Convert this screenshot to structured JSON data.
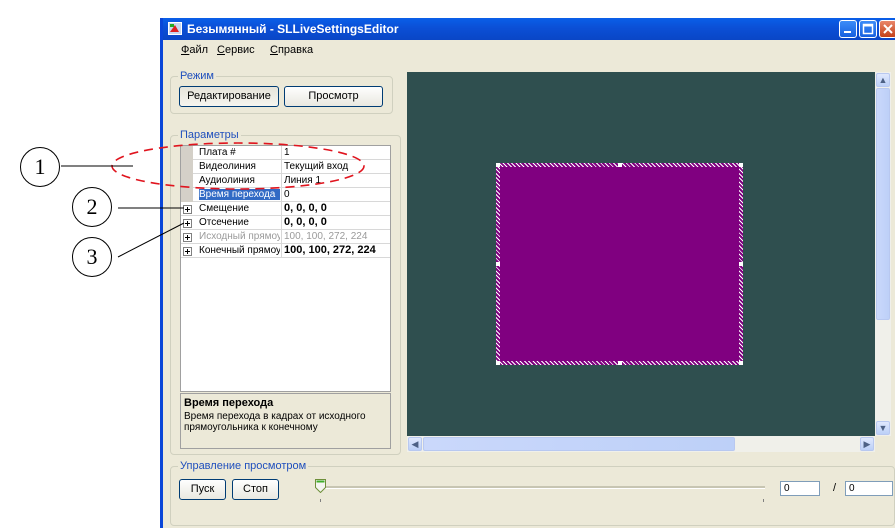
{
  "window": {
    "title": "Безымянный - SLLiveSettingsEditor"
  },
  "menu": [
    "Файл",
    "Сервис",
    "Справка"
  ],
  "mode_group": {
    "title": "Режим",
    "edit_label": "Редактирование",
    "view_label": "Просмотр"
  },
  "params_group": {
    "title": "Параметры",
    "rows": [
      {
        "name": "Плата #",
        "value": "1"
      },
      {
        "name": "Видеолиния",
        "value": "Текущий вход"
      },
      {
        "name": "Аудиолиния",
        "value": "Линия 1"
      },
      {
        "name": "Время перехода",
        "value": "0"
      },
      {
        "name": "Смещение",
        "value": "0, 0, 0, 0"
      },
      {
        "name": "Отсечение",
        "value": "0, 0, 0, 0"
      },
      {
        "name": "Исходный прямоугольник",
        "value": "100, 100, 272, 224"
      },
      {
        "name": "Конечный прямоугольник",
        "value": "100, 100, 272, 224"
      }
    ],
    "help_title": "Время перехода",
    "help_text": "Время перехода в кадрах от исходного прямоугольника к конечному"
  },
  "playback_group": {
    "title": "Управление просмотром",
    "play_label": "Пуск",
    "stop_label": "Стоп",
    "current_frame": "0",
    "separator": "/",
    "total_frames": "0"
  },
  "callouts": [
    "1",
    "2",
    "3"
  ],
  "colors": {
    "preview_bg": "#2f4f4f",
    "rect_fill": "#800080",
    "annotation_dash": "#e0141e",
    "group_title": "#1f4fbd"
  },
  "icons": {
    "app": "app-icon",
    "minimize": "minimize-icon",
    "maximize": "maximize-icon",
    "close": "close-icon"
  }
}
